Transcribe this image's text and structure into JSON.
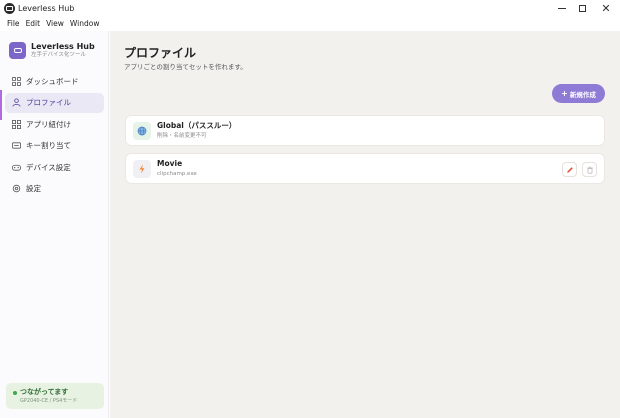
{
  "window": {
    "title": "Leverless Hub"
  },
  "menu": {
    "file": "File",
    "edit": "Edit",
    "view": "View",
    "window": "Window"
  },
  "sidebar": {
    "brand_name": "Leverless Hub",
    "brand_sub": "左手デバイス化ツール",
    "items": [
      {
        "label": "ダッシュボード",
        "icon": "grid-icon",
        "active": false
      },
      {
        "label": "プロファイル",
        "icon": "user-icon",
        "active": true
      },
      {
        "label": "アプリ紐付け",
        "icon": "apps-icon",
        "active": false
      },
      {
        "label": "キー割り当て",
        "icon": "keyboard-icon",
        "active": false
      },
      {
        "label": "デバイス設定",
        "icon": "gamepad-icon",
        "active": false
      },
      {
        "label": "設定",
        "icon": "gear-icon",
        "active": false
      }
    ],
    "status": {
      "title": "つながってます",
      "sub": "GP2040-CE / PS4モード"
    }
  },
  "main": {
    "title": "プロファイル",
    "subtitle": "アプリごとの割り当てセットを作れます。",
    "new_button": "新規作成",
    "profiles": [
      {
        "name": "Global（パススルー）",
        "sub": "削除・名前変更不可",
        "icon": "globe-icon"
      },
      {
        "name": "Movie",
        "sub": "clipchamp.exe",
        "icon": "bolt-icon"
      }
    ]
  },
  "colors": {
    "accent": "#8d7bd6",
    "brand": "#7c67c9",
    "status_bg": "#e7f2e2",
    "edit_icon": "#e0553b"
  }
}
